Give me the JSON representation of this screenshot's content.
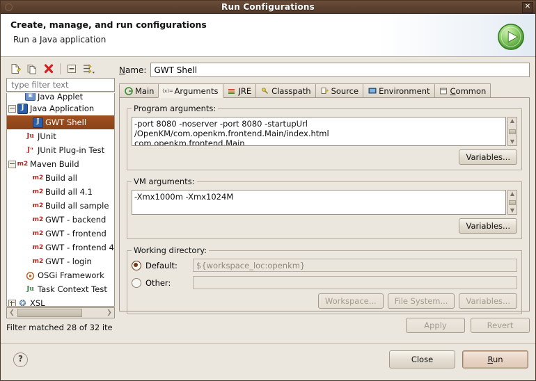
{
  "window": {
    "title": "Run Configurations",
    "close_label": "✕"
  },
  "banner": {
    "heading": "Create, manage, and run configurations",
    "subheading": "Run a Java application",
    "icon": "run-play-icon"
  },
  "sidebar": {
    "toolbar": [
      {
        "name": "new-configuration-icon",
        "label": "New"
      },
      {
        "name": "duplicate-configuration-icon",
        "label": "Duplicate"
      },
      {
        "name": "delete-configuration-icon",
        "label": "Delete"
      },
      {
        "name": "collapse-all-icon",
        "label": "Collapse All"
      },
      {
        "name": "filter-configurations-icon",
        "label": "Filter"
      }
    ],
    "filter": {
      "value": "",
      "placeholder": "type filter text"
    },
    "tree": [
      {
        "label": "Java Applet",
        "icon": "java-applet-icon",
        "indent": 1,
        "twist": "none",
        "selected": false,
        "clipped": true
      },
      {
        "label": "Java Application",
        "icon": "java-application-icon",
        "indent": 0,
        "twist": "minus",
        "selected": false,
        "clipped": false
      },
      {
        "label": "GWT Shell",
        "icon": "java-application-icon",
        "indent": 2,
        "twist": "none",
        "selected": true,
        "clipped": false
      },
      {
        "label": "JUnit",
        "icon": "junit-icon",
        "indent": 1,
        "twist": "none",
        "selected": false,
        "clipped": false
      },
      {
        "label": "JUnit Plug-in Test",
        "icon": "junit-plugin-icon",
        "indent": 1,
        "twist": "none",
        "selected": false,
        "clipped": false
      },
      {
        "label": "Maven Build",
        "icon": "maven-icon",
        "indent": 0,
        "twist": "minus",
        "selected": false,
        "clipped": false
      },
      {
        "label": "Build all",
        "icon": "maven-icon",
        "indent": 2,
        "twist": "none",
        "selected": false,
        "clipped": false
      },
      {
        "label": "Build all 4.1",
        "icon": "maven-icon",
        "indent": 2,
        "twist": "none",
        "selected": false,
        "clipped": false
      },
      {
        "label": "Build all sample",
        "icon": "maven-icon",
        "indent": 2,
        "twist": "none",
        "selected": false,
        "clipped": false
      },
      {
        "label": "GWT - backend",
        "icon": "maven-icon",
        "indent": 2,
        "twist": "none",
        "selected": false,
        "clipped": false
      },
      {
        "label": "GWT - frontend",
        "icon": "maven-icon",
        "indent": 2,
        "twist": "none",
        "selected": false,
        "clipped": false
      },
      {
        "label": "GWT - frontend 4.",
        "icon": "maven-icon",
        "indent": 2,
        "twist": "none",
        "selected": false,
        "clipped": false
      },
      {
        "label": "GWT - login",
        "icon": "maven-icon",
        "indent": 2,
        "twist": "none",
        "selected": false,
        "clipped": false
      },
      {
        "label": "OSGi Framework",
        "icon": "osgi-icon",
        "indent": 1,
        "twist": "none",
        "selected": false,
        "clipped": false
      },
      {
        "label": "Task Context Test",
        "icon": "task-context-icon",
        "indent": 1,
        "twist": "none",
        "selected": false,
        "clipped": false
      },
      {
        "label": "XSL",
        "icon": "xsl-icon",
        "indent": 0,
        "twist": "plus",
        "selected": false,
        "clipped": false
      }
    ],
    "status": "Filter matched 28 of 32 ite"
  },
  "main": {
    "name_field": {
      "label": "Name:",
      "label_mnemonic": "N",
      "value": "GWT Shell"
    },
    "tabs": [
      {
        "label": "Main",
        "icon": "main-tab-icon",
        "active": false,
        "mnemonic": ""
      },
      {
        "label": "Arguments",
        "icon": "arguments-tab-icon",
        "active": true,
        "mnemonic": ""
      },
      {
        "label": "JRE",
        "icon": "jre-tab-icon",
        "active": false,
        "mnemonic": ""
      },
      {
        "label": "Classpath",
        "icon": "classpath-tab-icon",
        "active": false,
        "mnemonic": ""
      },
      {
        "label": "Source",
        "icon": "source-tab-icon",
        "active": false,
        "mnemonic": ""
      },
      {
        "label": "Environment",
        "icon": "environment-tab-icon",
        "active": false,
        "mnemonic": ""
      },
      {
        "label": "Common",
        "icon": "common-tab-icon",
        "active": false,
        "mnemonic": "C"
      }
    ],
    "program_arguments": {
      "legend": "Program arguments:",
      "value": "-port 8080 -noserver -port 8080 -startupUrl  /OpenKM/com.openkm.frontend.Main/index.html\ncom.openkm.frontend.Main",
      "variables_button": "Variables..."
    },
    "vm_arguments": {
      "legend": "VM arguments:",
      "value": "-Xmx1000m -Xmx1024M",
      "variables_button": "Variables..."
    },
    "working_directory": {
      "legend": "Working directory:",
      "default_label": "Default:",
      "default_value": "${workspace_loc:openkm}",
      "default_selected": true,
      "other_label": "Other:",
      "other_value": "",
      "other_selected": false,
      "workspace_button": "Workspace...",
      "filesystem_button": "File System...",
      "variables_button": "Variables..."
    },
    "apply_button": "Apply",
    "revert_button": "Revert"
  },
  "footer": {
    "help_icon": "?",
    "close_button": "Close",
    "run_button": "Run"
  },
  "colors": {
    "titlebar": "#5b4130",
    "selection": "#8a4318",
    "dialog_bg": "#ece7de",
    "accent_green": "#5faf3c",
    "maven_red": "#b32020"
  }
}
